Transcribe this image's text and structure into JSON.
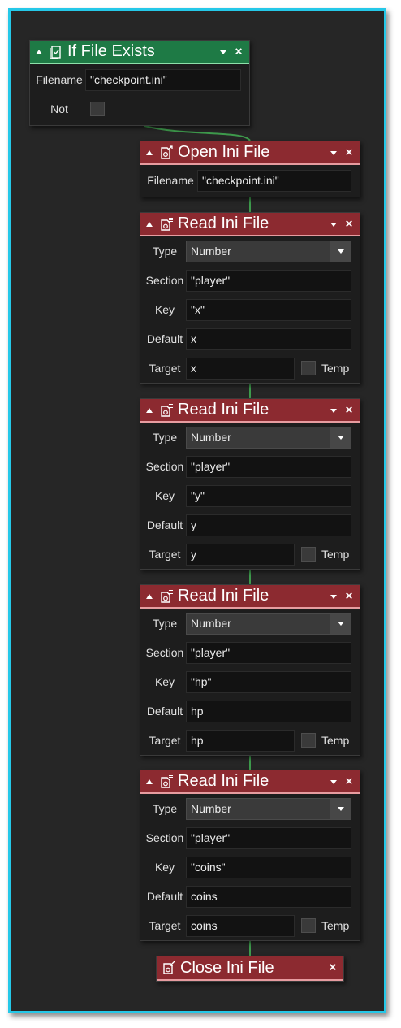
{
  "if_file_exists": {
    "title": "If File Exists",
    "icon": "file-check-icon",
    "filename_label": "Filename",
    "filename_value": "\"checkpoint.ini\"",
    "not_label": "Not",
    "not_checked": false
  },
  "open_ini": {
    "title": "Open Ini File",
    "icon": "file-open-icon",
    "filename_label": "Filename",
    "filename_value": "\"checkpoint.ini\""
  },
  "read_blocks": [
    {
      "title": "Read Ini File",
      "icon": "file-read-icon",
      "type_label": "Type",
      "type_value": "Number",
      "section_label": "Section",
      "section_value": "\"player\"",
      "key_label": "Key",
      "key_value": "\"x\"",
      "default_label": "Default",
      "default_value": "x",
      "target_label": "Target",
      "target_value": "x",
      "temp_label": "Temp",
      "temp_checked": false
    },
    {
      "title": "Read Ini File",
      "icon": "file-read-icon",
      "type_label": "Type",
      "type_value": "Number",
      "section_label": "Section",
      "section_value": "\"player\"",
      "key_label": "Key",
      "key_value": "\"y\"",
      "default_label": "Default",
      "default_value": "y",
      "target_label": "Target",
      "target_value": "y",
      "temp_label": "Temp",
      "temp_checked": false
    },
    {
      "title": "Read Ini File",
      "icon": "file-read-icon",
      "type_label": "Type",
      "type_value": "Number",
      "section_label": "Section",
      "section_value": "\"player\"",
      "key_label": "Key",
      "key_value": "\"hp\"",
      "default_label": "Default",
      "default_value": "hp",
      "target_label": "Target",
      "target_value": "hp",
      "temp_label": "Temp",
      "temp_checked": false
    },
    {
      "title": "Read Ini File",
      "icon": "file-read-icon",
      "type_label": "Type",
      "type_value": "Number",
      "section_label": "Section",
      "section_value": "\"player\"",
      "key_label": "Key",
      "key_value": "\"coins\"",
      "default_label": "Default",
      "default_value": "coins",
      "target_label": "Target",
      "target_value": "coins",
      "temp_label": "Temp",
      "temp_checked": false
    }
  ],
  "close_ini": {
    "title": "Close Ini File",
    "icon": "file-close-icon"
  },
  "colors": {
    "frame_border": "#25c8e8",
    "canvas": "#262626",
    "condition_header": "#1e7a45",
    "action_header": "#8c2a30",
    "wire": "#3e9a4c"
  }
}
